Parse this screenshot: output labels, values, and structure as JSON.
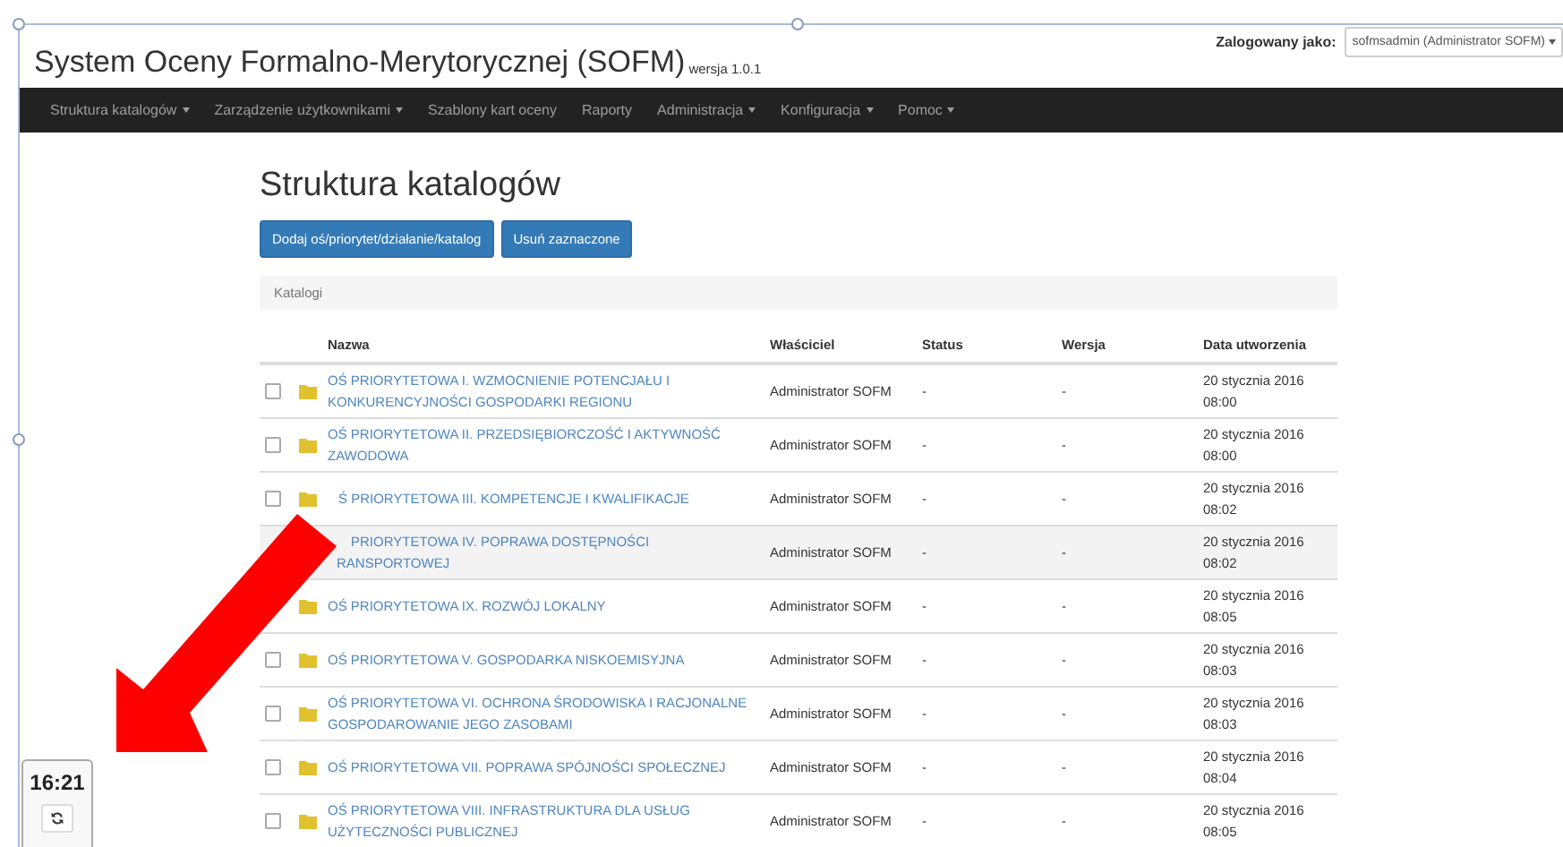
{
  "header": {
    "title": "System Oceny Formalno-Merytorycznej (SOFM)",
    "version": "wersja 1.0.1",
    "login_label": "Zalogowany jako:",
    "user": "sofmsadmin (Administrator SOFM)"
  },
  "nav": [
    {
      "label": "Struktura katalogów",
      "dropdown": true
    },
    {
      "label": "Zarządzenie użytkownikami",
      "dropdown": true
    },
    {
      "label": "Szablony kart oceny",
      "dropdown": false
    },
    {
      "label": "Raporty",
      "dropdown": false
    },
    {
      "label": "Administracja",
      "dropdown": true
    },
    {
      "label": "Konfiguracja",
      "dropdown": true
    },
    {
      "label": "Pomoc",
      "dropdown": true
    }
  ],
  "page_title": "Struktura katalogów",
  "buttons": [
    "Dodaj oś/priorytet/działanie/katalog",
    "Usuń zaznaczone"
  ],
  "panel_title": "Katalogi",
  "table": {
    "columns": [
      "Nazwa",
      "Właściciel",
      "Status",
      "Wersja",
      "Data utworzenia"
    ],
    "rows": [
      {
        "name": "OŚ PRIORYTETOWA I. WZMOCNIENIE POTENCJAŁU I KONKURENCYJNOŚCI GOSPODARKI REGIONU",
        "owner": "Administrator SOFM",
        "status": "-",
        "version": "-",
        "date": "20 stycznia 2016 08:00",
        "checked": false,
        "highlighted": false
      },
      {
        "name": "OŚ PRIORYTETOWA II. PRZEDSIĘBIORCZOŚĆ I AKTYWNOŚĆ ZAWODOWA",
        "owner": "Administrator SOFM",
        "status": "-",
        "version": "-",
        "date": "20 stycznia 2016 08:00",
        "checked": false,
        "highlighted": false
      },
      {
        "name": "Ś PRIORYTETOWA III. KOMPETENCJE I KWALIFIKACJE",
        "owner": "Administrator SOFM",
        "status": "-",
        "version": "-",
        "date": "20 stycznia 2016 08:02",
        "checked": false,
        "highlighted": false
      },
      {
        "name": "PRIORYTETOWA IV. POPRAWA DOSTĘPNOŚCI RANSPORTOWEJ",
        "owner": "Administrator SOFM",
        "status": "-",
        "version": "-",
        "date": "20 stycznia 2016 08:02",
        "highlighted": true
      },
      {
        "name": "OŚ PRIORYTETOWA IX. ROZWÓJ LOKALNY",
        "owner": "Administrator SOFM",
        "status": "-",
        "version": "-",
        "date": "20 stycznia 2016 08:05",
        "highlighted": false
      },
      {
        "name": "OŚ PRIORYTETOWA V. GOSPODARKA NISKOEMISYJNA",
        "owner": "Administrator SOFM",
        "status": "-",
        "version": "-",
        "date": "20 stycznia 2016 08:03",
        "checked": false,
        "highlighted": false
      },
      {
        "name": "OŚ PRIORYTETOWA VI. OCHRONA ŚRODOWISKA I RACJONALNE GOSPODAROWANIE JEGO ZASOBAMI",
        "owner": "Administrator SOFM",
        "status": "-",
        "version": "-",
        "date": "20 stycznia 2016 08:03",
        "checked": false,
        "highlighted": false
      },
      {
        "name": "OŚ PRIORYTETOWA VII. POPRAWA SPÓJNOŚCI SPOŁECZNEJ",
        "owner": "Administrator SOFM",
        "status": "-",
        "version": "-",
        "date": "20 stycznia 2016 08:04",
        "checked": false,
        "highlighted": false
      },
      {
        "name": "OŚ PRIORYTETOWA VIII. INFRASTRUKTURA DLA USŁUG UŻYTECZNOŚCI PUBLICZNEJ",
        "owner": "Administrator SOFM",
        "status": "-",
        "version": "-",
        "date": "20 stycznia 2016 08:05",
        "checked": false,
        "highlighted": false
      }
    ]
  },
  "clock": {
    "time": "16:21"
  }
}
